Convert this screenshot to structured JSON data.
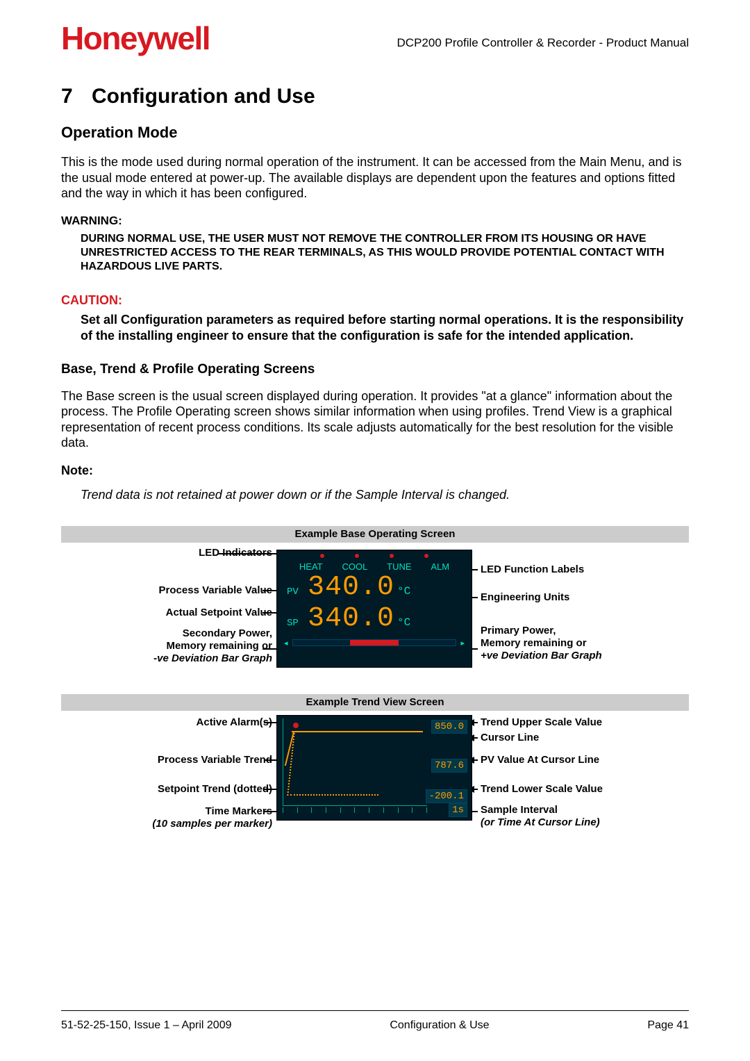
{
  "header": {
    "brand": "Honeywell",
    "subtitle": "DCP200 Profile Controller & Recorder - Product Manual"
  },
  "section": {
    "number": "7",
    "title": "Configuration and Use"
  },
  "operation_mode": {
    "heading": "Operation Mode",
    "body": "This is the mode used during normal operation of the instrument. It can be accessed from the Main Menu, and is the usual mode entered at power-up. The available displays are dependent upon the features and options fitted and the way in which it has been configured."
  },
  "warning": {
    "label": "WARNING:",
    "body": "DURING NORMAL USE, THE USER MUST NOT REMOVE THE CONTROLLER FROM ITS HOUSING OR HAVE UNRESTRICTED ACCESS TO THE REAR TERMINALS, AS THIS WOULD PROVIDE POTENTIAL CONTACT WITH HAZARDOUS LIVE PARTS."
  },
  "caution": {
    "label": "CAUTION:",
    "body": "Set all Configuration parameters as required before starting normal operations. It is the responsibility of the installing engineer to ensure that the configuration is safe for the intended application."
  },
  "screens_intro": {
    "heading": "Base, Trend & Profile Operating Screens",
    "body": "The Base screen is the usual screen displayed during operation. It provides \"at a glance\" information about the process. The Profile Operating screen shows similar information when using profiles. Trend View is a graphical representation of recent process conditions. Its scale adjusts automatically for the best resolution for the visible data."
  },
  "note": {
    "label": "Note:",
    "body": "Trend data is not retained at power down or if the Sample Interval is changed."
  },
  "base_diagram": {
    "title": "Example Base Operating Screen",
    "fn_labels": {
      "l1": "HEAT",
      "l2": "COOL",
      "l3": "TUNE",
      "l4": "ALM"
    },
    "pv_label": "PV",
    "sp_label": "SP",
    "value": "340.0",
    "unit": "°C",
    "left": {
      "led_indicators": "LED Indicators",
      "pv_value": "Process Variable Value",
      "sp_value": "Actual Setpoint Value",
      "secondary_l1": "Secondary Power,",
      "secondary_l2": "Memory remaining or",
      "secondary_l3": "-ve Deviation Bar Graph"
    },
    "right": {
      "led_fn": "LED Function Labels",
      "eng_units": "Engineering Units",
      "primary_l1": "Primary Power,",
      "primary_l2": "Memory remaining or",
      "primary_l3": "+ve Deviation Bar Graph"
    }
  },
  "trend_diagram": {
    "title": "Example Trend View Screen",
    "upper_scale": "850.0",
    "pv_at_cursor": "787.6",
    "lower_scale": "-200.1",
    "sample_interval": "1s",
    "left": {
      "alarm": "Active Alarm(s)",
      "pv_trend": "Process Variable Trend",
      "sp_trend": "Setpoint Trend (dotted)",
      "time_markers_l1": "Time Markers",
      "time_markers_l2": "(10 samples per marker)"
    },
    "right": {
      "upper": "Trend Upper Scale Value",
      "cursor": "Cursor Line",
      "pv_cursor": "PV Value At Cursor Line",
      "lower": "Trend Lower Scale Value",
      "sample_l1": "Sample Interval",
      "sample_l2": "(or Time At Cursor Line)"
    }
  },
  "footer": {
    "left": "51-52-25-150, Issue 1 – April 2009",
    "center": "Configuration & Use",
    "right": "Page 41"
  }
}
